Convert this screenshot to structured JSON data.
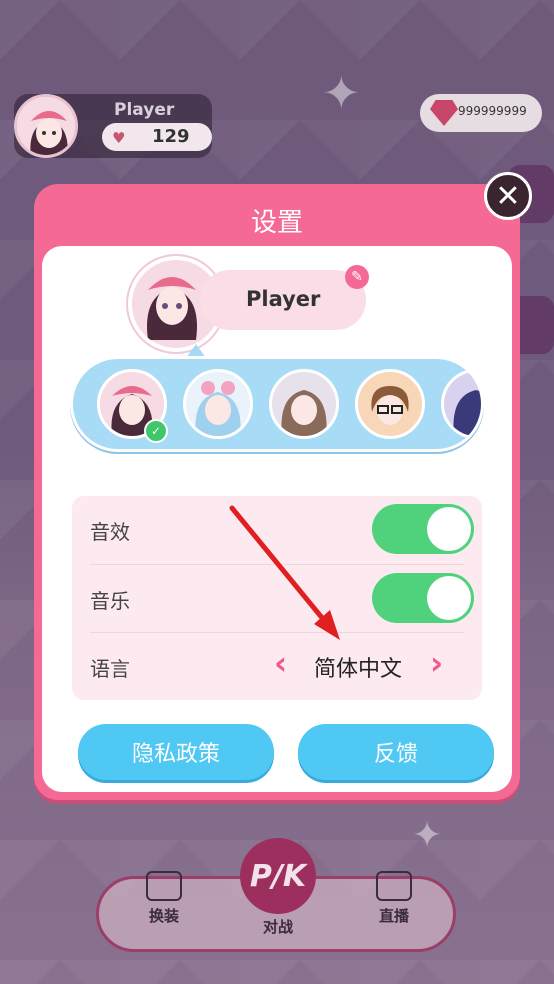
{
  "player": {
    "name": "Player",
    "hearts": "129"
  },
  "currency": {
    "gems": "999999999"
  },
  "nav": {
    "dress_label": "换装",
    "battle_label": "对战",
    "battle_badge": "P/K",
    "live_label": "直播"
  },
  "dialog": {
    "title": "设置",
    "close_symbol": "✕",
    "profile_name": "Player",
    "edit_icon": "pencil-icon",
    "avatars": [
      "avatar-pink-beret-girl",
      "avatar-blue-hair-girl",
      "avatar-brown-hair-girl",
      "avatar-glasses-boy",
      "avatar-purple-hair"
    ],
    "selected_avatar": 0,
    "settings": {
      "sound_label": "音效",
      "sound_on": true,
      "music_label": "音乐",
      "music_on": true,
      "language_label": "语言",
      "language_value": "简体中文",
      "prev_symbol": "‹",
      "next_symbol": "›"
    },
    "privacy_button": "隐私政策",
    "feedback_button": "反馈"
  },
  "colors": {
    "dialog": "#f56a95",
    "toggle_on": "#4fd27b",
    "button": "#4fc8f4",
    "arrow": "#e02020"
  }
}
